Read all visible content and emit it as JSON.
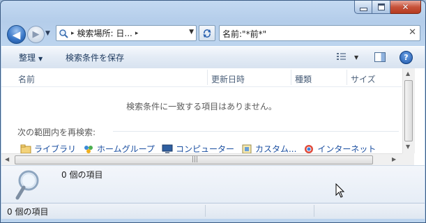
{
  "window": {
    "caption_minimize": "",
    "caption_maximize": "",
    "caption_close": "✕"
  },
  "nav": {
    "back_glyph": "◀",
    "forward_glyph": "▶",
    "history_glyph": "▼"
  },
  "address": {
    "separator_1": "▸",
    "text": "検索場所: 日...",
    "separator_2": "▸",
    "dropdown_glyph": "▼"
  },
  "search": {
    "value": "名前:\"*前*\"",
    "clear_glyph": "✕"
  },
  "toolbar": {
    "organize_label": "整理",
    "organize_arrow": "▼",
    "save_search_label": "検索条件を保存",
    "view_arrow": "▼",
    "help_label": "?"
  },
  "columns": [
    "名前",
    "更新日時",
    "種類",
    "サイズ"
  ],
  "results": {
    "empty_message": "検索条件に一致する項目はありません。",
    "search_again_label": "次の範囲内を再検索:",
    "locations": [
      {
        "label": "ライブラリ",
        "icon": "library-icon"
      },
      {
        "label": "ホームグループ",
        "icon": "homegroup-icon"
      },
      {
        "label": "コンピューター",
        "icon": "computer-icon"
      },
      {
        "label": "カスタム...",
        "icon": "custom-icon"
      },
      {
        "label": "インターネット",
        "icon": "internet-icon"
      }
    ]
  },
  "details": {
    "count_text": "0 個の項目"
  },
  "status": {
    "text": "0 個の項目"
  }
}
